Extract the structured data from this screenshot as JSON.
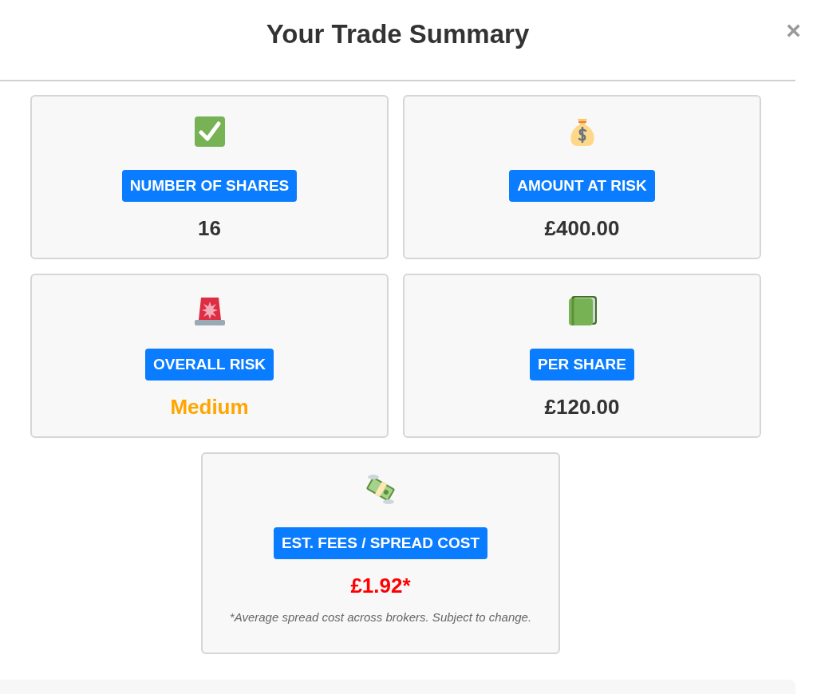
{
  "dialog": {
    "title": "Your Trade Summary",
    "close": "×"
  },
  "cards": [
    {
      "label": "NUMBER OF SHARES",
      "value": "16",
      "color": "#333333"
    },
    {
      "label": "AMOUNT AT RISK",
      "value": "£400.00",
      "color": "#333333"
    },
    {
      "label": "OVERALL RISK",
      "value": "Medium",
      "color": "#ffa500"
    },
    {
      "label": "PER SHARE",
      "value": "£120.00",
      "color": "#333333"
    },
    {
      "label": "EST. FEES / SPREAD COST",
      "value": "£1.92*",
      "color": "#ff0000",
      "note": "*Average spread cost across brokers. Subject to change."
    }
  ]
}
